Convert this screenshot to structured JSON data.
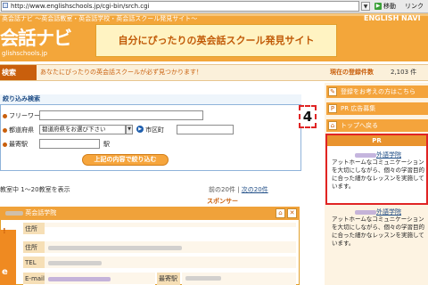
{
  "browser": {
    "url": "http://www.englishschools.jp/cgi-bin/srch.cgi",
    "go_label": "移動",
    "links_label": "リンク"
  },
  "header": {
    "tagline": "英会話ナビ 〜英会話教室・英会話学校・英会話スクール発見サイト〜",
    "brand_nav": "ENGLISH NAVI",
    "logo": "会話ナビ",
    "logo_sub": "glishschools.jp",
    "banner": "自分にぴったりの英会話スクール発見サイト"
  },
  "subbar": {
    "tab": "検索",
    "message": "あなたにぴったりの英会話スクールが必ず見つかります！",
    "count_label": "現在の登録件数",
    "count_value": "2,103 件"
  },
  "search": {
    "title": "絞り込み検索",
    "keyword_label": "フリーワード",
    "pref_label": "都道府県",
    "pref_value": "都道府県をお選び下さい",
    "town_label": "市区町",
    "station_label": "最寄駅",
    "station_suffix": "駅",
    "submit_label": "上記の内容で絞り込む"
  },
  "results": {
    "summary": "教室中 1〜20教室を表示",
    "prev": "前の20件",
    "separator": " | ",
    "next": "次の20件"
  },
  "sponsor": {
    "label": "スポンサー",
    "head": "英会話学院",
    "rows": [
      {
        "label": "住所"
      },
      {
        "label": "TEL"
      },
      {
        "label": "E-mail"
      }
    ],
    "station_label": "最寄駅",
    "thumb_char": "e",
    "bang": "!"
  },
  "sidebar": {
    "btn1": "登録をお考えの方はこちら",
    "btn2": "PR 広告募集",
    "btn3": "トップへ戻る",
    "btn1_icon": "pencil-icon",
    "btn2_icon": "pr-icon",
    "btn3_icon": "home-icon"
  },
  "callout": "4",
  "pr": {
    "header": "PR",
    "title1": "外語学院",
    "body1": "アットホームなコミュニケーションを大切にしながら、個々の学習目的に合った細かなレッスンを実施しています。",
    "title2": "外語学院",
    "body2": "アットホームなコミュニケーションを大切にしながら、個々の学習目的に合った細かなレッスンを実施しています。"
  }
}
